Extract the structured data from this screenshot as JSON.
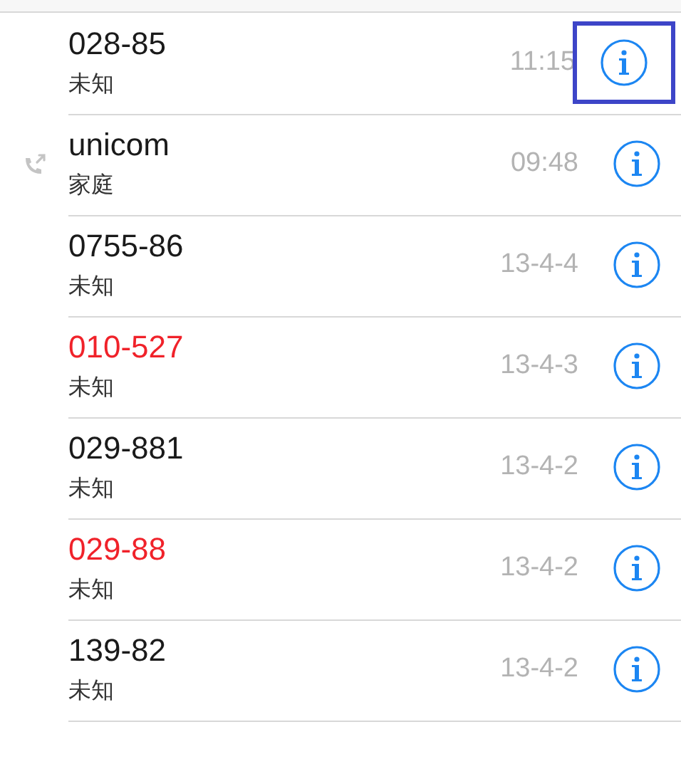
{
  "calls": [
    {
      "number": "028-85",
      "label": "未知",
      "time": "11:15",
      "missed": false,
      "outgoing": false,
      "highlighted": true
    },
    {
      "number": "unicom",
      "label": "家庭",
      "time": "09:48",
      "missed": false,
      "outgoing": true,
      "highlighted": false
    },
    {
      "number": "0755-86",
      "label": "未知",
      "time": "13-4-4",
      "missed": false,
      "outgoing": false,
      "highlighted": false
    },
    {
      "number": "010-527",
      "label": "未知",
      "time": "13-4-3",
      "missed": true,
      "outgoing": false,
      "highlighted": false
    },
    {
      "number": "029-881",
      "label": "未知",
      "time": "13-4-2",
      "missed": false,
      "outgoing": false,
      "highlighted": false
    },
    {
      "number": "029-88",
      "label": "未知",
      "time": "13-4-2",
      "missed": true,
      "outgoing": false,
      "highlighted": false
    },
    {
      "number": "139-82",
      "label": "未知",
      "time": "13-4-2",
      "missed": false,
      "outgoing": false,
      "highlighted": false
    }
  ]
}
